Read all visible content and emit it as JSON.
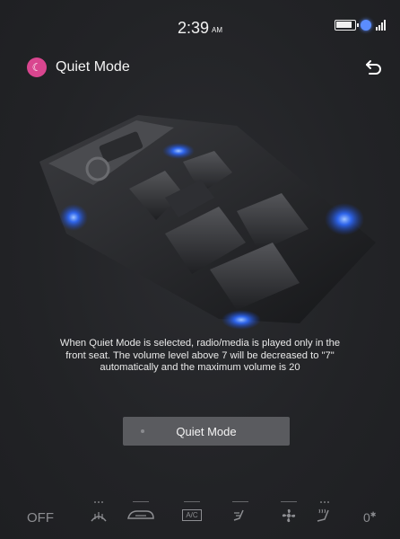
{
  "status": {
    "time": "2:39",
    "ampm": "AM",
    "icons": [
      "battery-icon",
      "voice-assistant-icon",
      "signal-icon"
    ]
  },
  "header": {
    "title": "Quiet Mode",
    "icon": "moon-icon",
    "back_icon": "back-arrow-icon"
  },
  "illustration": {
    "icon": "car-cabin-speakers-illustration",
    "accent_color": "#2f6bff"
  },
  "description": "When Quiet Mode is selected, radio/media is played only in the front seat. The volume level above 7 will be decreased to \"7\" automatically and the maximum volume is 20",
  "quiet_button": {
    "label": "Quiet Mode"
  },
  "climate": {
    "off_label": "OFF",
    "ac_label": "A/C",
    "temp_value": "0",
    "temp_unit_icon": "fan-speed-icon",
    "items": [
      "rear-defrost-icon",
      "recirculation-icon",
      "ac-icon",
      "seat-airflow-icon",
      "fan-icon",
      "seat-heat-icon"
    ]
  },
  "colors": {
    "background": "#232427",
    "accent_pink": "#d9468f",
    "speaker_glow": "#2f6bff",
    "button": "#5a5b5f"
  }
}
